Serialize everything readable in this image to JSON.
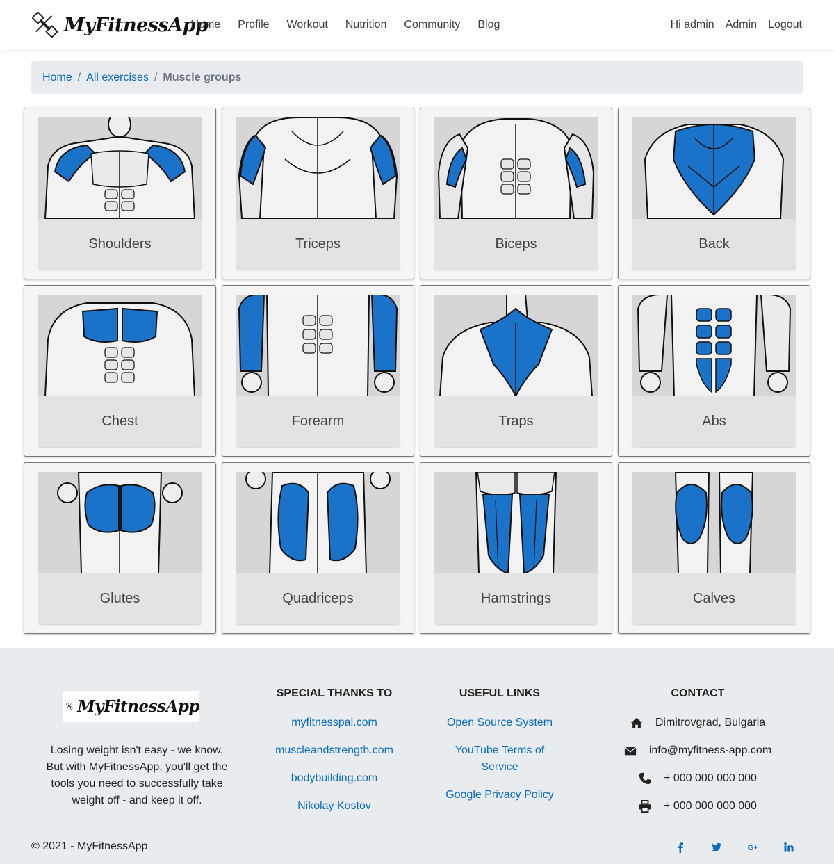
{
  "brand": {
    "name": "MyFitnessApp"
  },
  "nav": {
    "links": [
      "Home",
      "Profile",
      "Workout",
      "Nutrition",
      "Community",
      "Blog"
    ],
    "greeting": "Hi admin",
    "admin": "Admin",
    "logout": "Logout"
  },
  "breadcrumb": {
    "home": "Home",
    "all": "All exercises",
    "current": "Muscle groups"
  },
  "muscle_groups": [
    {
      "label": "Shoulders",
      "icon": "muscle-shoulders-illustration"
    },
    {
      "label": "Triceps",
      "icon": "muscle-triceps-illustration"
    },
    {
      "label": "Biceps",
      "icon": "muscle-biceps-illustration"
    },
    {
      "label": "Back",
      "icon": "muscle-back-illustration"
    },
    {
      "label": "Chest",
      "icon": "muscle-chest-illustration"
    },
    {
      "label": "Forearm",
      "icon": "muscle-forearm-illustration"
    },
    {
      "label": "Traps",
      "icon": "muscle-traps-illustration"
    },
    {
      "label": "Abs",
      "icon": "muscle-abs-illustration"
    },
    {
      "label": "Glutes",
      "icon": "muscle-glutes-illustration"
    },
    {
      "label": "Quadriceps",
      "icon": "muscle-quadriceps-illustration"
    },
    {
      "label": "Hamstrings",
      "icon": "muscle-hamstrings-illustration"
    },
    {
      "label": "Calves",
      "icon": "muscle-calves-illustration"
    }
  ],
  "footer": {
    "about": "Losing weight isn't easy - we know. But with MyFitnessApp, you'll get the tools you need to successfully take weight off - and keep it off.",
    "thanks": {
      "title": "SPECIAL THANKS TO",
      "links": [
        "myfitnesspal.com",
        "muscleandstrength.com",
        "bodybuilding.com",
        "Nikolay Kostov"
      ]
    },
    "useful": {
      "title": "USEFUL LINKS",
      "links": [
        "Open Source System",
        "YouTube Terms of Service",
        "Google Privacy Policy"
      ]
    },
    "contact": {
      "title": "CONTACT",
      "address": "Dimitrovgrad, Bulgaria",
      "email": "info@myfitness-app.com",
      "phone": "+ 000 000 000 000",
      "fax": "+ 000 000 000 000"
    },
    "copyright": "© 2021 - MyFitnessApp",
    "socials": [
      "facebook-icon",
      "twitter-icon",
      "google-plus-icon",
      "linkedin-icon"
    ]
  },
  "colors": {
    "accent": "#0a6bbd",
    "muscle": "#1a73c8",
    "breadcrumb_bg": "#e9ecef",
    "card_bg": "#f5f5f5",
    "label_bg": "#e2e3e5"
  }
}
